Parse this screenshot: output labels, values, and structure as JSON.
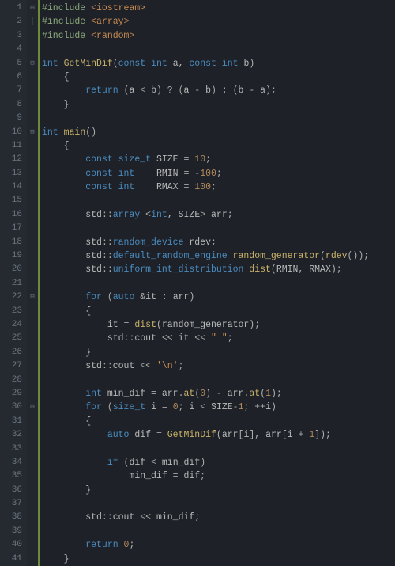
{
  "editor": {
    "lines": [
      {
        "n": 1,
        "fold": "⊟",
        "segs": [
          [
            "pp",
            "#include "
          ],
          [
            "angle",
            "<iostream>"
          ]
        ]
      },
      {
        "n": 2,
        "fold": "│",
        "segs": [
          [
            "pp",
            "#include "
          ],
          [
            "angle",
            "<array>"
          ]
        ]
      },
      {
        "n": 3,
        "fold": "",
        "segs": [
          [
            "pp",
            "#include "
          ],
          [
            "angle",
            "<random>"
          ]
        ]
      },
      {
        "n": 4,
        "fold": "",
        "segs": []
      },
      {
        "n": 5,
        "fold": "⊟",
        "segs": [
          [
            "kw",
            "int"
          ],
          [
            "op",
            " "
          ],
          [
            "fn",
            "GetMinDif"
          ],
          [
            "punc",
            "("
          ],
          [
            "kw",
            "const int"
          ],
          [
            "op",
            " "
          ],
          [
            "var",
            "a"
          ],
          [
            "punc",
            ", "
          ],
          [
            "kw",
            "const int"
          ],
          [
            "op",
            " "
          ],
          [
            "var",
            "b"
          ],
          [
            "punc",
            ")"
          ]
        ]
      },
      {
        "n": 6,
        "fold": "",
        "indent": 1,
        "segs": [
          [
            "punc",
            "{"
          ]
        ]
      },
      {
        "n": 7,
        "fold": "",
        "indent": 2,
        "segs": [
          [
            "kw",
            "return"
          ],
          [
            "op",
            " ("
          ],
          [
            "var",
            "a"
          ],
          [
            "op",
            " < "
          ],
          [
            "var",
            "b"
          ],
          [
            "op",
            ") ? ("
          ],
          [
            "var",
            "a"
          ],
          [
            "op",
            " - "
          ],
          [
            "var",
            "b"
          ],
          [
            "op",
            ") : ("
          ],
          [
            "var",
            "b"
          ],
          [
            "op",
            " - "
          ],
          [
            "var",
            "a"
          ],
          [
            "op",
            ");"
          ]
        ]
      },
      {
        "n": 8,
        "fold": "",
        "indent": 1,
        "segs": [
          [
            "punc",
            "}"
          ]
        ]
      },
      {
        "n": 9,
        "fold": "",
        "segs": []
      },
      {
        "n": 10,
        "fold": "⊟",
        "segs": [
          [
            "kw",
            "int"
          ],
          [
            "op",
            " "
          ],
          [
            "fn",
            "main"
          ],
          [
            "punc",
            "()"
          ]
        ]
      },
      {
        "n": 11,
        "fold": "",
        "indent": 1,
        "segs": [
          [
            "punc",
            "{"
          ]
        ]
      },
      {
        "n": 12,
        "fold": "",
        "indent": 2,
        "segs": [
          [
            "kw",
            "const"
          ],
          [
            "op",
            " "
          ],
          [
            "type",
            "size_t"
          ],
          [
            "op",
            " "
          ],
          [
            "const",
            "SIZE"
          ],
          [
            "op",
            " = "
          ],
          [
            "num",
            "10"
          ],
          [
            "punc",
            ";"
          ]
        ]
      },
      {
        "n": 13,
        "fold": "",
        "indent": 2,
        "segs": [
          [
            "kw",
            "const int"
          ],
          [
            "op",
            "    "
          ],
          [
            "const",
            "RMIN"
          ],
          [
            "op",
            " = "
          ],
          [
            "op",
            "-"
          ],
          [
            "num",
            "100"
          ],
          [
            "punc",
            ";"
          ]
        ]
      },
      {
        "n": 14,
        "fold": "",
        "indent": 2,
        "segs": [
          [
            "kw",
            "const int"
          ],
          [
            "op",
            "    "
          ],
          [
            "const",
            "RMAX"
          ],
          [
            "op",
            " = "
          ],
          [
            "num",
            "100"
          ],
          [
            "punc",
            ";"
          ]
        ]
      },
      {
        "n": 15,
        "fold": "",
        "segs": []
      },
      {
        "n": 16,
        "fold": "",
        "indent": 2,
        "segs": [
          [
            "ns",
            "std"
          ],
          [
            "op",
            "::"
          ],
          [
            "type",
            "array"
          ],
          [
            "op",
            " <"
          ],
          [
            "kw",
            "int"
          ],
          [
            "punc",
            ", "
          ],
          [
            "const",
            "SIZE"
          ],
          [
            "op",
            "> "
          ],
          [
            "var",
            "arr"
          ],
          [
            "punc",
            ";"
          ]
        ]
      },
      {
        "n": 17,
        "fold": "",
        "segs": []
      },
      {
        "n": 18,
        "fold": "",
        "indent": 2,
        "segs": [
          [
            "ns",
            "std"
          ],
          [
            "op",
            "::"
          ],
          [
            "type",
            "random_device"
          ],
          [
            "op",
            " "
          ],
          [
            "var",
            "rdev"
          ],
          [
            "punc",
            ";"
          ]
        ]
      },
      {
        "n": 19,
        "fold": "",
        "indent": 2,
        "segs": [
          [
            "ns",
            "std"
          ],
          [
            "op",
            "::"
          ],
          [
            "type",
            "default_random_engine"
          ],
          [
            "op",
            " "
          ],
          [
            "fn",
            "random_generator"
          ],
          [
            "punc",
            "("
          ],
          [
            "fn",
            "rdev"
          ],
          [
            "punc",
            "());"
          ]
        ]
      },
      {
        "n": 20,
        "fold": "",
        "indent": 2,
        "segs": [
          [
            "ns",
            "std"
          ],
          [
            "op",
            "::"
          ],
          [
            "type",
            "uniform_int_distribution"
          ],
          [
            "op",
            " "
          ],
          [
            "fn",
            "dist"
          ],
          [
            "punc",
            "("
          ],
          [
            "const",
            "RMIN"
          ],
          [
            "punc",
            ", "
          ],
          [
            "const",
            "RMAX"
          ],
          [
            "punc",
            ");"
          ]
        ]
      },
      {
        "n": 21,
        "fold": "",
        "segs": []
      },
      {
        "n": 22,
        "fold": "⊟",
        "indent": 2,
        "segs": [
          [
            "kw",
            "for"
          ],
          [
            "op",
            " ("
          ],
          [
            "kw",
            "auto"
          ],
          [
            "op",
            " &"
          ],
          [
            "var",
            "it"
          ],
          [
            "op",
            " : "
          ],
          [
            "var",
            "arr"
          ],
          [
            "punc",
            ")"
          ]
        ]
      },
      {
        "n": 23,
        "fold": "",
        "indent": 2,
        "segs": [
          [
            "punc",
            "{"
          ]
        ]
      },
      {
        "n": 24,
        "fold": "",
        "indent": 3,
        "segs": [
          [
            "var",
            "it"
          ],
          [
            "op",
            " = "
          ],
          [
            "fn",
            "dist"
          ],
          [
            "punc",
            "("
          ],
          [
            "var",
            "random_generator"
          ],
          [
            "punc",
            ");"
          ]
        ]
      },
      {
        "n": 25,
        "fold": "",
        "indent": 3,
        "segs": [
          [
            "ns",
            "std"
          ],
          [
            "op",
            "::"
          ],
          [
            "var",
            "cout"
          ],
          [
            "op",
            " << "
          ],
          [
            "var",
            "it"
          ],
          [
            "op",
            " << "
          ],
          [
            "str",
            "\" \""
          ],
          [
            "punc",
            ";"
          ]
        ]
      },
      {
        "n": 26,
        "fold": "",
        "indent": 2,
        "segs": [
          [
            "punc",
            "}"
          ]
        ]
      },
      {
        "n": 27,
        "fold": "",
        "indent": 2,
        "segs": [
          [
            "ns",
            "std"
          ],
          [
            "op",
            "::"
          ],
          [
            "var",
            "cout"
          ],
          [
            "op",
            " << "
          ],
          [
            "str",
            "'\\n'"
          ],
          [
            "punc",
            ";"
          ]
        ]
      },
      {
        "n": 28,
        "fold": "",
        "segs": []
      },
      {
        "n": 29,
        "fold": "",
        "indent": 2,
        "segs": [
          [
            "kw",
            "int"
          ],
          [
            "op",
            " "
          ],
          [
            "var",
            "min_dif"
          ],
          [
            "op",
            " = "
          ],
          [
            "var",
            "arr"
          ],
          [
            "op",
            "."
          ],
          [
            "fn",
            "at"
          ],
          [
            "punc",
            "("
          ],
          [
            "num",
            "0"
          ],
          [
            "punc",
            ")"
          ],
          [
            "op",
            " - "
          ],
          [
            "var",
            "arr"
          ],
          [
            "op",
            "."
          ],
          [
            "fn",
            "at"
          ],
          [
            "punc",
            "("
          ],
          [
            "num",
            "1"
          ],
          [
            "punc",
            ");"
          ]
        ]
      },
      {
        "n": 30,
        "fold": "⊟",
        "indent": 2,
        "segs": [
          [
            "kw",
            "for"
          ],
          [
            "op",
            " ("
          ],
          [
            "type",
            "size_t"
          ],
          [
            "op",
            " "
          ],
          [
            "var",
            "i"
          ],
          [
            "op",
            " = "
          ],
          [
            "num",
            "0"
          ],
          [
            "punc",
            "; "
          ],
          [
            "var",
            "i"
          ],
          [
            "op",
            " < "
          ],
          [
            "const",
            "SIZE"
          ],
          [
            "op",
            "-"
          ],
          [
            "num",
            "1"
          ],
          [
            "punc",
            "; "
          ],
          [
            "op",
            "++"
          ],
          [
            "var",
            "i"
          ],
          [
            "punc",
            ")"
          ]
        ]
      },
      {
        "n": 31,
        "fold": "",
        "indent": 2,
        "segs": [
          [
            "punc",
            "{"
          ]
        ]
      },
      {
        "n": 32,
        "fold": "",
        "indent": 3,
        "segs": [
          [
            "kw",
            "auto"
          ],
          [
            "op",
            " "
          ],
          [
            "var",
            "dif"
          ],
          [
            "op",
            " = "
          ],
          [
            "fn",
            "GetMinDif"
          ],
          [
            "punc",
            "("
          ],
          [
            "var",
            "arr"
          ],
          [
            "punc",
            "["
          ],
          [
            "var",
            "i"
          ],
          [
            "punc",
            "], "
          ],
          [
            "var",
            "arr"
          ],
          [
            "punc",
            "["
          ],
          [
            "var",
            "i"
          ],
          [
            "op",
            " + "
          ],
          [
            "num",
            "1"
          ],
          [
            "punc",
            "]);"
          ]
        ]
      },
      {
        "n": 33,
        "fold": "",
        "segs": []
      },
      {
        "n": 34,
        "fold": "",
        "indent": 3,
        "segs": [
          [
            "kw",
            "if"
          ],
          [
            "op",
            " ("
          ],
          [
            "var",
            "dif"
          ],
          [
            "op",
            " < "
          ],
          [
            "var",
            "min_dif"
          ],
          [
            "punc",
            ")"
          ]
        ]
      },
      {
        "n": 35,
        "fold": "",
        "indent": 4,
        "segs": [
          [
            "var",
            "min_dif"
          ],
          [
            "op",
            " = "
          ],
          [
            "var",
            "dif"
          ],
          [
            "punc",
            ";"
          ]
        ]
      },
      {
        "n": 36,
        "fold": "",
        "indent": 2,
        "segs": [
          [
            "punc",
            "}"
          ]
        ]
      },
      {
        "n": 37,
        "fold": "",
        "segs": []
      },
      {
        "n": 38,
        "fold": "",
        "indent": 2,
        "segs": [
          [
            "ns",
            "std"
          ],
          [
            "op",
            "::"
          ],
          [
            "var",
            "cout"
          ],
          [
            "op",
            " << "
          ],
          [
            "var",
            "min_dif"
          ],
          [
            "punc",
            ";"
          ]
        ]
      },
      {
        "n": 39,
        "fold": "",
        "segs": []
      },
      {
        "n": 40,
        "fold": "",
        "indent": 2,
        "segs": [
          [
            "kw",
            "return"
          ],
          [
            "op",
            " "
          ],
          [
            "num",
            "0"
          ],
          [
            "punc",
            ";"
          ]
        ]
      },
      {
        "n": 41,
        "fold": "",
        "indent": 1,
        "segs": [
          [
            "punc",
            "}"
          ]
        ]
      }
    ]
  }
}
